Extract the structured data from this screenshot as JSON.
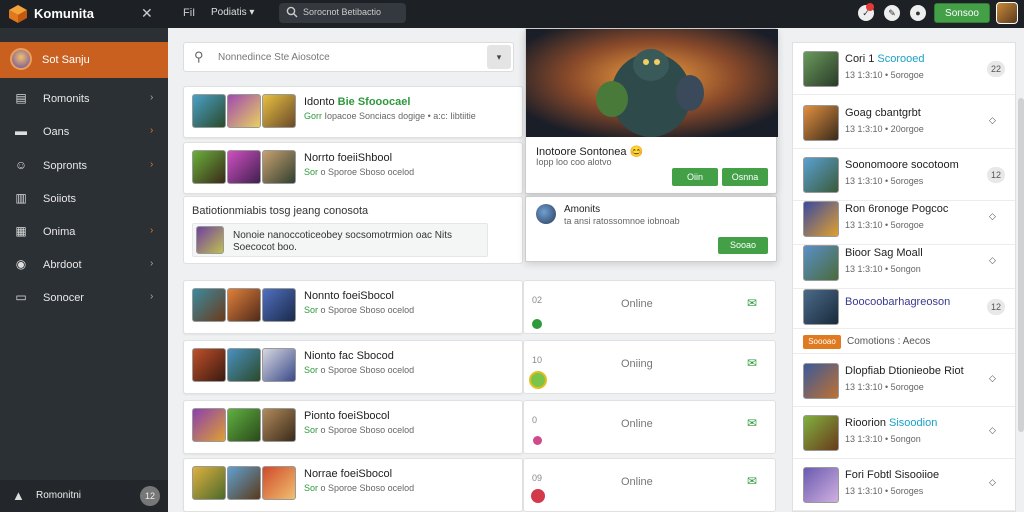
{
  "topbar": {
    "brand": "Komunita",
    "close_glyph": "✕",
    "grid_label": "FiI",
    "menu_label": "Podiatis",
    "menu_chevron": "▾",
    "search_text": "Sorocnot Betibactio",
    "icon_notify_glyph": "✓",
    "icon_edit_glyph": "✎",
    "icon_settings_glyph": "●",
    "action_button": "Sonsoo"
  },
  "sidebar": {
    "active_label": "Sot Sanju",
    "items": [
      {
        "icon": "▤",
        "label": "Romonits",
        "chevron": "›"
      },
      {
        "icon": "▬",
        "label": "Oans",
        "chevron": "›"
      },
      {
        "icon": "☺",
        "label": "Sopronts",
        "chevron": "›"
      },
      {
        "icon": "▥",
        "label": "Soiiots",
        "chevron": ""
      },
      {
        "icon": "▦",
        "label": "Onima",
        "chevron": "›"
      },
      {
        "icon": "◉",
        "label": "Abrdoot",
        "chevron": "›"
      },
      {
        "icon": "▭",
        "label": "Sonocer",
        "chevron": "›"
      }
    ],
    "footer_label": "Romonitni",
    "footer_count": "12"
  },
  "main": {
    "search_placeholder": "Nonnedince Ste Aiosotce",
    "search_dropdown": "▾",
    "cards": [
      {
        "title": "Idonto",
        "title_hl": "Bie Sfooocael",
        "meta_hl": "Gorr",
        "meta": "Iopacoe Sonciacs dogige • a:c: Iibtiitie"
      },
      {
        "title": "Norrto foeiiShbool",
        "title_hl": "",
        "meta_hl": "Sor",
        "meta": "o Sporoe Sboso ocelod"
      }
    ],
    "group": {
      "title": "Batiotionmiabis tosg jeang conosota",
      "text": "Nonoie nanoccoticeobey socsomotrmion oac Nits Soecocot boo."
    },
    "list_cards": [
      {
        "title": "Nonnto foeiSbocol",
        "meta_hl": "Sor",
        "meta": "o Sporoe Sboso ocelod"
      },
      {
        "title": "Nionto fac Sbocod",
        "meta_hl": "Sor",
        "meta": "o Sporoe Sboso ocelod"
      },
      {
        "title": "Pionto foeiSbocol",
        "meta_hl": "Sor",
        "meta": "o Sporoe Sboso ocelod"
      },
      {
        "title": "Norrae foeiSbocol",
        "meta_hl": "Sor",
        "meta": "o Sporoe Sboso ocelod"
      }
    ]
  },
  "status_rows": [
    {
      "num": "02",
      "online": "Online",
      "dot_color": "#2e9a3c",
      "chat_glyph": "💬"
    },
    {
      "num": "10",
      "online": "Oniing",
      "dot_color": "#7cc34a",
      "chat_glyph": "💬"
    },
    {
      "num": "0",
      "online": "Online",
      "dot_color": "#d04a8a",
      "chat_glyph": "💬"
    },
    {
      "num": "09",
      "online": "Online",
      "dot_color": "#d23a4a",
      "chat_glyph": "💬"
    }
  ],
  "popover": {
    "title": "Inotoore Sontonea",
    "title_emoji": "😊",
    "subtitle": "Iopp loo coo alotvo",
    "btn1": "Oiin",
    "btn2": "Osnna"
  },
  "friend_popover": {
    "name": "Amonits",
    "subtitle": "ta ansi ratossomnoe iobnoab",
    "button": "Sooao"
  },
  "right": {
    "items": [
      {
        "title": "Cori 1",
        "title_hl": "Scorooed",
        "meta": "13 1:3:10 • 5orogoe",
        "count": "22",
        "pill": true
      },
      {
        "title": "Goag cbantgrbt",
        "title_hl": "",
        "meta": "13 1:3:10 • 20orgoe",
        "count": "◇",
        "pill": false
      },
      {
        "title": "Soonomoore socotoom",
        "title_hl": "",
        "meta": "13 1:3:10 • 5oroges",
        "count": "12",
        "pill": true
      },
      {
        "title": "Ron 6ronoge Pogcoc",
        "title_hl": "",
        "meta": "13 1:3:10 • 5orogoe",
        "count": "◇",
        "pill": false
      },
      {
        "title": "Bioor Sag Moall",
        "title_hl": "",
        "meta": "13 1:3:10 • 5ongon",
        "count": "◇",
        "pill": false
      },
      {
        "title": "Boocoobarhagreoson",
        "title_hl": "",
        "meta": "",
        "count": "12",
        "pill": true
      }
    ],
    "separator_tag": "Soooao",
    "separator_label": "Comotions : Aecos",
    "items2": [
      {
        "title": "Dlopfiab",
        "title_hl": "",
        "title2": "Dtionieobe Riot",
        "meta": "13 1:3:10 • 5orogoe",
        "count": "◇"
      },
      {
        "title": "Rioorion",
        "title_hl": "Sisoodion",
        "meta": "13 1:3:10 • 5ongon",
        "count": "◇"
      },
      {
        "title": "Fori Fobtl",
        "title_hl": "",
        "title2": "Sisooiioe",
        "meta": "13 1:3:10 • 5oroges",
        "count": "◇"
      }
    ]
  },
  "colors": {
    "topbar_bg": "#1d2125",
    "sidebar_bg": "#2b3035",
    "sidebar_active": "#c9601f",
    "accent_green": "#43a047",
    "link_blue": "#1aa0c8"
  }
}
